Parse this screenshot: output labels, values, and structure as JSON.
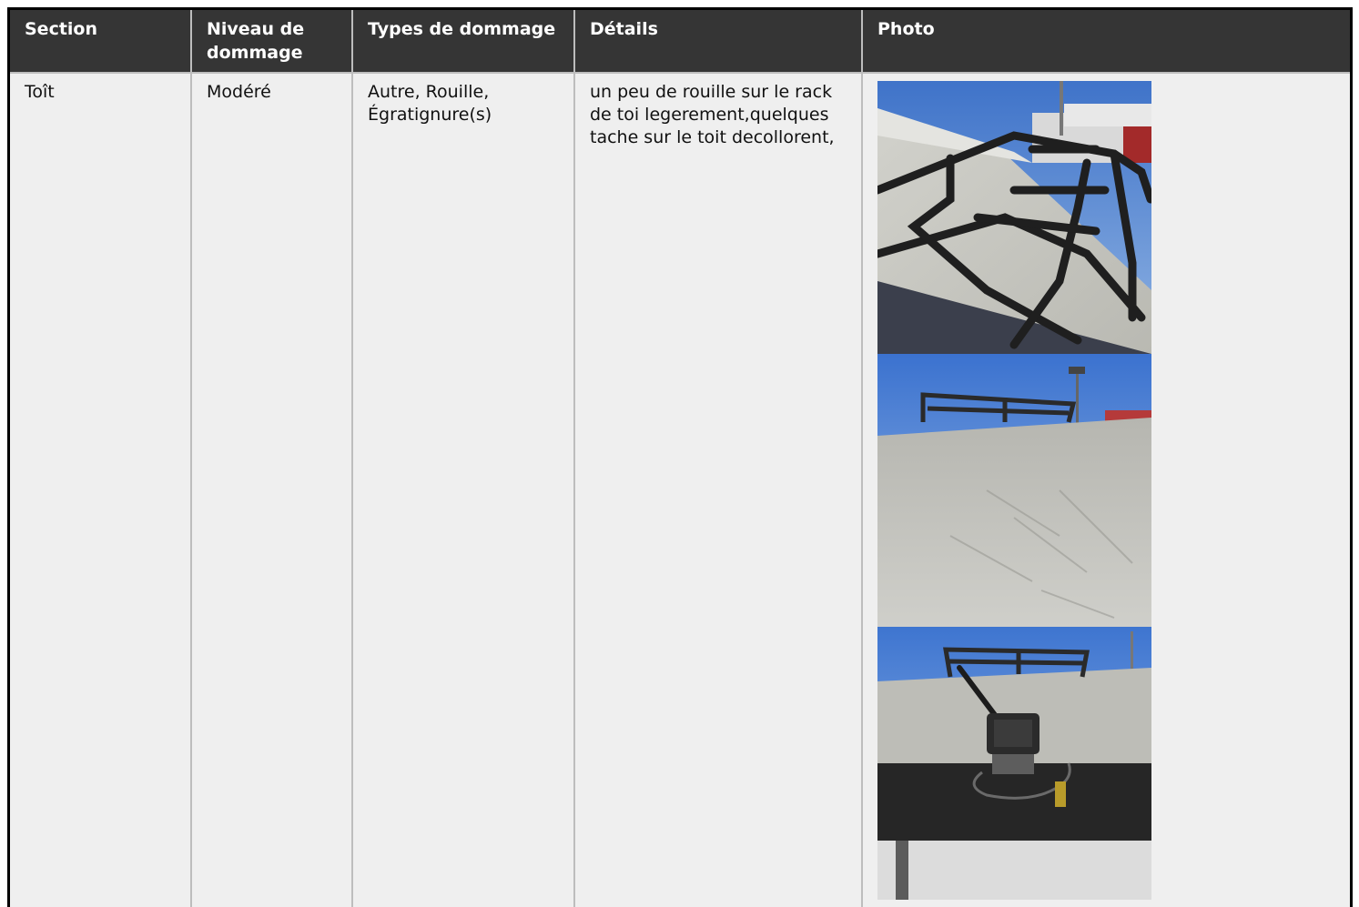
{
  "table": {
    "headers": [
      "Section",
      "Niveau de dommage",
      "Types de dommage",
      "Détails",
      "Photo"
    ],
    "row": {
      "section": "Toît",
      "niveau": "Modéré",
      "types": "Autre, Rouille, Égratignure(s)",
      "details": "un peu de rouille sur le rack de toi legerement,quelques tache sur le toit decollorent,"
    },
    "photos": [
      {
        "name": "photo-roof-rack-closeup"
      },
      {
        "name": "photo-roof-surface"
      },
      {
        "name": "photo-roof-camera"
      }
    ]
  }
}
